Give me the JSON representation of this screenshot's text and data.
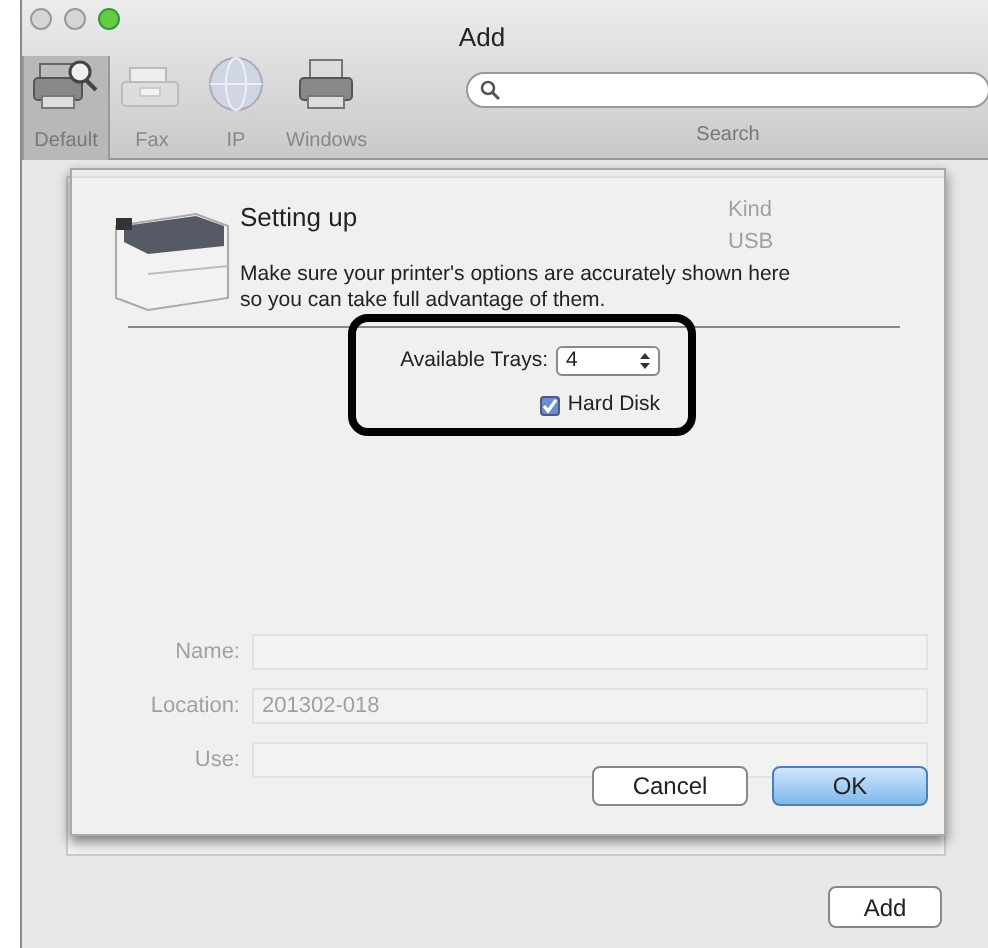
{
  "window": {
    "title": "Add"
  },
  "toolbar": [
    {
      "label": "Default",
      "selected": true
    },
    {
      "label": "Fax",
      "selected": false
    },
    {
      "label": "IP",
      "selected": false
    },
    {
      "label": "Windows",
      "selected": false
    }
  ],
  "search": {
    "label": "Search"
  },
  "background_list": {
    "column_2": "Kind",
    "row_value": "USB"
  },
  "background_form": [
    {
      "label": "Name:"
    },
    {
      "label": "Location:",
      "value": "201302-018"
    },
    {
      "label": "Use:"
    }
  ],
  "sheet": {
    "title": "Setting up",
    "description": "Make sure your printer's options are accurately shown here so you can take full advantage of them.",
    "options": [
      {
        "kind": "select",
        "label": "Available Trays:",
        "value": "4"
      },
      {
        "kind": "checkbox",
        "label": "Hard Disk",
        "checked": true
      }
    ],
    "buttons": [
      {
        "label": "Cancel",
        "default": false
      },
      {
        "label": "OK",
        "default": true
      }
    ]
  },
  "add_button": "Add"
}
